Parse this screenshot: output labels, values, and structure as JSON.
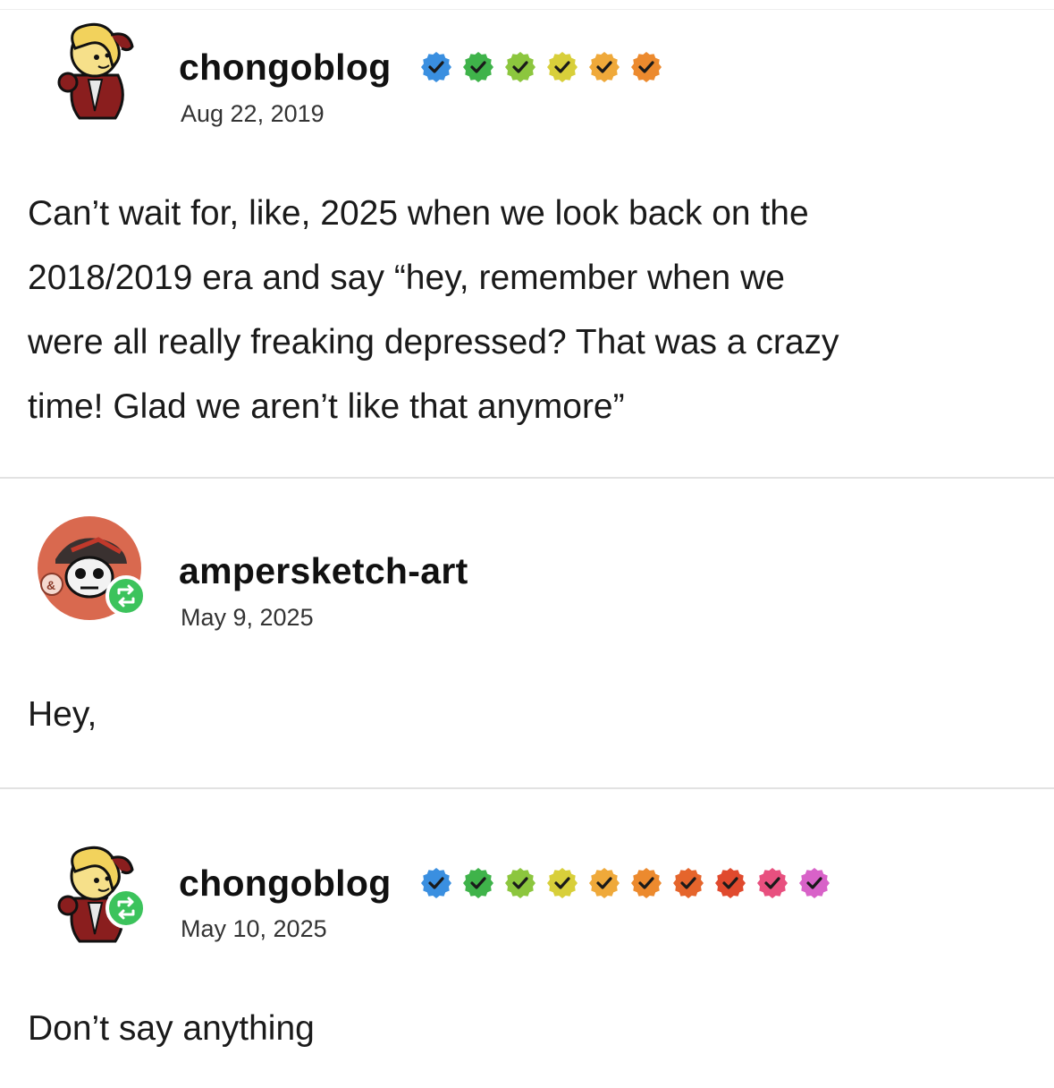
{
  "posts": [
    {
      "username": "chongoblog",
      "date": "Aug 22, 2019",
      "body_lines": [
        "Can’t wait for, like, 2025 when we look back on the",
        "2018/2019 era and say “hey, remember when we",
        "were all really freaking depressed? That was a crazy",
        "time! Glad we aren’t like that anymore”"
      ],
      "reblog": false,
      "badge_colors": [
        "#3a8fe0",
        "#3fb34a",
        "#8cc63e",
        "#d8cf3a",
        "#efa93a",
        "#ec8a2e"
      ]
    },
    {
      "username": "ampersketch-art",
      "date": "May 9, 2025",
      "body_lines": [
        "Hey,"
      ],
      "reblog": true,
      "badge_colors": []
    },
    {
      "username": "chongoblog",
      "date": "May 10, 2025",
      "body_lines": [
        "Don’t say anything"
      ],
      "reblog": true,
      "badge_colors": [
        "#3a8fe0",
        "#3fb34a",
        "#8cc63e",
        "#d8cf3a",
        "#efa93a",
        "#ec8a2e",
        "#e5652c",
        "#e04a2e",
        "#e8507f",
        "#d862c8"
      ]
    }
  ],
  "icons": {
    "avatar_chongoblog": "cartoon-girl-avatar",
    "avatar_ampersketch": "skull-pirate-avatar",
    "reblog": "reblog-icon",
    "verified": "verified-check-badge"
  },
  "colors": {
    "reblog_green": "#3cc35c",
    "ampersketch_bg": "#d9694f"
  }
}
